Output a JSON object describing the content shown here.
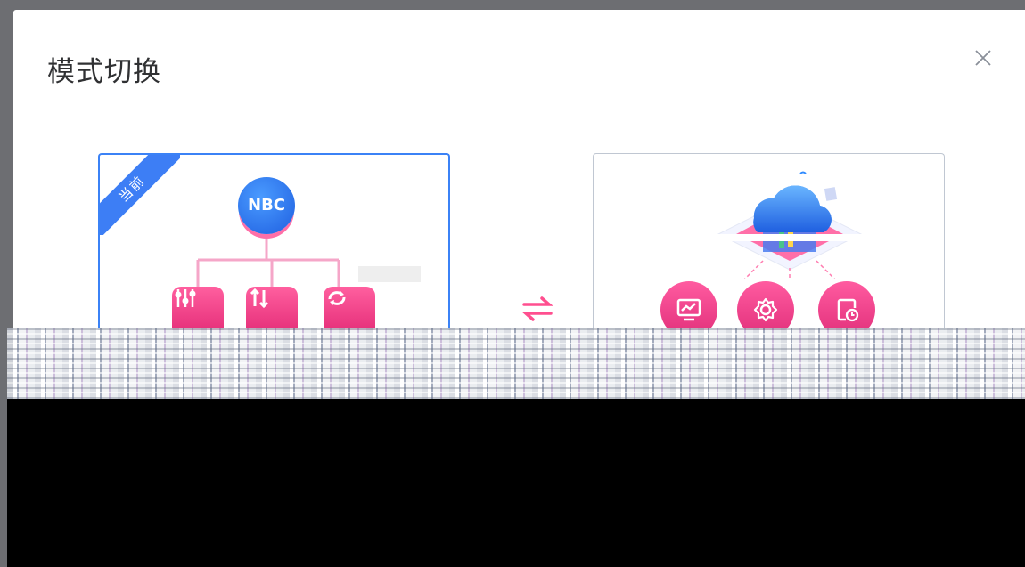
{
  "dialog": {
    "title": "模式切换",
    "close_icon": "close-icon"
  },
  "cards": [
    {
      "id": "current-mode",
      "badge": "当前",
      "node_label": "NBC",
      "selected": true,
      "icons": [
        "sliders-icon",
        "transfer-icon",
        "refresh-icon"
      ]
    },
    {
      "id": "cloud-mode",
      "selected": false,
      "icons": [
        "monitor-chart-icon",
        "settings-icon",
        "clock-document-icon"
      ]
    }
  ],
  "switch_icon": "swap-arrows-icon",
  "colors": {
    "accent_blue": "#3d7ef5",
    "accent_pink": "#ff4f94",
    "overlay": "#6d6e72"
  }
}
